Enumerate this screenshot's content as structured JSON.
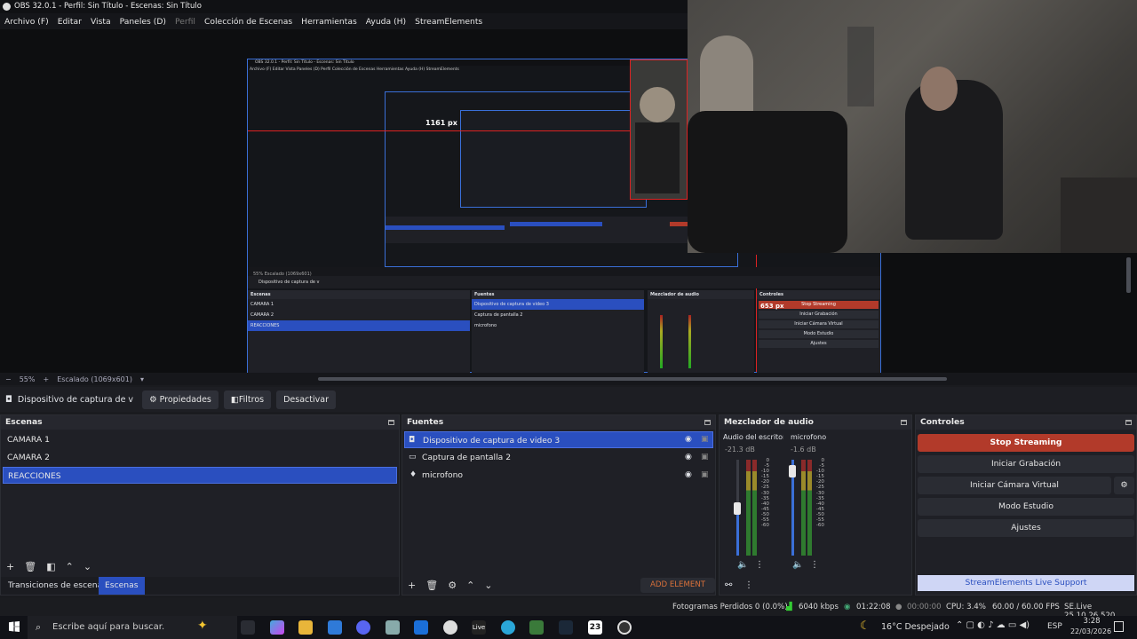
{
  "window": {
    "title": "OBS 32.0.1 - Perfil: Sin Título - Escenas: Sin Título"
  },
  "menu": [
    "Archivo (F)",
    "Editar",
    "Vista",
    "Paneles (D)",
    "Perfil",
    "Colección de Escenas",
    "Herramientas",
    "Ayuda (H)",
    "StreamElements"
  ],
  "nested": {
    "title": "OBS 32.0.1 - Perfil: Sin Título - Escenas: Sin Título",
    "width_label": "1161 px",
    "width_label2": "653 px",
    "zoom": "55%",
    "scaled": "Escalado (1069x601)",
    "source": "Dispositivo de captura de v"
  },
  "zoombar": {
    "zoom": "55%",
    "scaled": "Escalado (1069x601)"
  },
  "sourcebar": {
    "source_name": "Dispositivo de captura de v",
    "properties": "Propiedades",
    "filters": "Filtros",
    "deactivate": "Desactivar"
  },
  "scenes": {
    "title": "Escenas",
    "items": [
      "CAMARA 1",
      "CAMARA 2",
      "REACCIONES"
    ],
    "tab1": "Transiciones de escena",
    "tab2": "Escenas"
  },
  "sources": {
    "title": "Fuentes",
    "items": [
      "Dispositivo de captura de video 3",
      "Captura de pantalla 2",
      "microfono"
    ],
    "add_element": "ADD ELEMENT"
  },
  "mixer": {
    "title": "Mezclador de audio",
    "ch1": {
      "name": "Audio del escritorio",
      "db": "-21.3 dB"
    },
    "ch2": {
      "name": "microfono",
      "db": "-1.6 dB"
    },
    "scale": [
      "0",
      "-5",
      "-10",
      "-15",
      "-20",
      "-25",
      "-30",
      "-35",
      "-40",
      "-45",
      "-50",
      "-55",
      "-60"
    ]
  },
  "controls": {
    "title": "Controles",
    "stop": "Stop Streaming",
    "record": "Iniciar Grabación",
    "virtualcam": "Iniciar Cámara Virtual",
    "studio": "Modo Estudio",
    "settings": "Ajustes",
    "support": "StreamElements Live Support"
  },
  "status": {
    "dropped": "Fotogramas Perdidos 0 (0.0%)",
    "kbps": "6040 kbps",
    "live_time": "01:22:08",
    "rec_time": "00:00:00",
    "cpu": "CPU: 3.4%",
    "fps": "60.00 / 60.00 FPS",
    "version": "SE.Live 25.10.26.520"
  },
  "taskbar": {
    "search": "Escribe aquí para buscar.",
    "weather": "16°C  Despejado",
    "lang": "ESP",
    "time": "3:28",
    "date": "22/03/2026",
    "badge": "23"
  },
  "colors": {
    "accent": "#2a4fbf",
    "stream": "#b23a2a",
    "bg": "#1f2026"
  }
}
